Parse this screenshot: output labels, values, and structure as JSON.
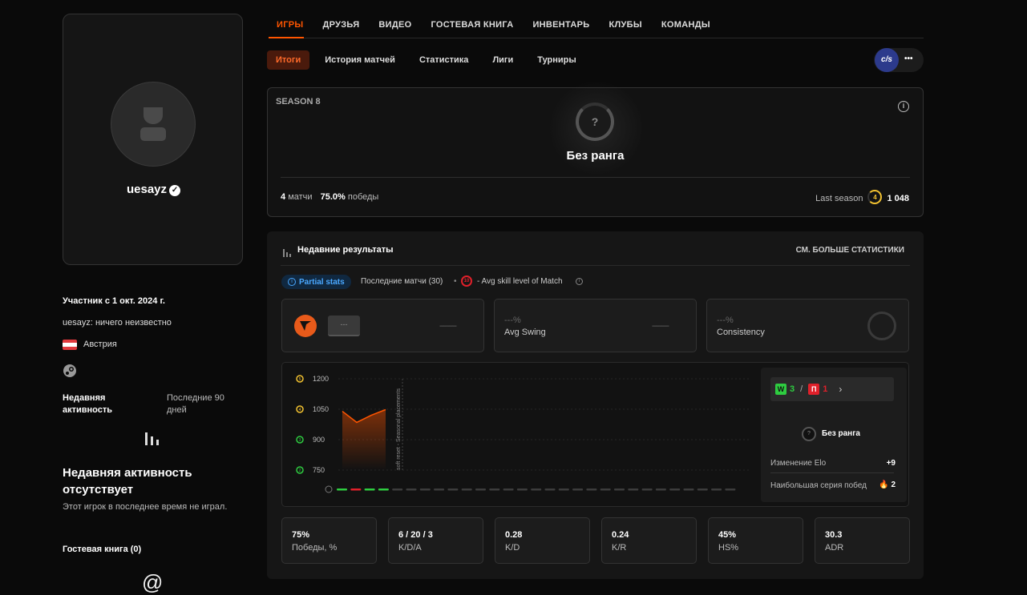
{
  "profile": {
    "nickname": "uesayz",
    "member_since": "Участник с 1 окт. 2024 г.",
    "bio": "uesayz: ничего неизвестно",
    "country": "Австрия",
    "recent_activity_label": "Недавняя активность",
    "recent_activity_period": "Последние 90 дней",
    "no_activity_title": "Недавняя активность отсутствует",
    "no_activity_text": "Этот игрок в последнее время не играл.",
    "guestbook": "Гостевая книга (0)"
  },
  "nav": {
    "top_tabs": [
      "ИГРЫ",
      "ДРУЗЬЯ",
      "ВИДЕО",
      "ГОСТЕВАЯ КНИГА",
      "ИНВЕНТАРЬ",
      "КЛУБЫ",
      "КОМАНДЫ"
    ],
    "sub_tabs": [
      "Итоги",
      "История матчей",
      "Статистика",
      "Лиги",
      "Турниры"
    ],
    "game_badge": "c/s",
    "more": "•••"
  },
  "season": {
    "title": "SEASON 8",
    "rank": "Без ранга",
    "matches_value": "4",
    "matches_label": "матчи",
    "wins_value": "75.0%",
    "wins_label": "победы",
    "last_season_label": "Last season",
    "last_level": "4",
    "last_elo": "1 048"
  },
  "recent": {
    "title": "Недавние результаты",
    "more_link": "СМ. БОЛЬШЕ СТАТИСТИКИ",
    "partial": "Partial stats",
    "last_matches": "Последние матчи (30)",
    "skill_badge": "10",
    "skill_text": "- Avg skill level of Match",
    "card1_value": "---",
    "card1_dash": "---------",
    "swing_value": "---%",
    "swing_label": "Avg Swing",
    "swing_dash": "---------",
    "consistency_value": "---%",
    "consistency_label": "Consistency"
  },
  "elo_panel": {
    "w_badge": "W",
    "w_count": "3",
    "sep": "/",
    "l_badge": "П",
    "l_count": "1",
    "rank": "Без ранга",
    "elo_change_label": "Изменение Elo",
    "elo_change_value": "+9",
    "streak_label": "Наибольшая серия побед",
    "streak_value": "2"
  },
  "chart_data": {
    "type": "area",
    "y_ticks": [
      {
        "label": "1200",
        "level": "5"
      },
      {
        "label": "1050",
        "level": "4"
      },
      {
        "label": "900",
        "level": "3"
      },
      {
        "label": "750",
        "level": "2"
      }
    ],
    "ylim": [
      750,
      1200
    ],
    "x": [
      1,
      2,
      3,
      4
    ],
    "values": [
      1040,
      985,
      1020,
      1048
    ],
    "annotation": "soft reset - Seasonal placements",
    "results": [
      "W",
      "L",
      "W",
      "W"
    ]
  },
  "stats": [
    {
      "value": "75%",
      "label": "Победы, %"
    },
    {
      "value": "6 / 20 / 3",
      "label": "K/D/A"
    },
    {
      "value": "0.28",
      "label": "K/D"
    },
    {
      "value": "0.24",
      "label": "K/R"
    },
    {
      "value": "45%",
      "label": "HS%"
    },
    {
      "value": "30.3",
      "label": "ADR"
    }
  ],
  "colors": {
    "accent": "#ff5500",
    "win": "#2ecc40",
    "loss": "#e0202a",
    "partial": "#4aa8ff",
    "level_gold": "#f2c230",
    "level_green": "#2ecc40"
  }
}
